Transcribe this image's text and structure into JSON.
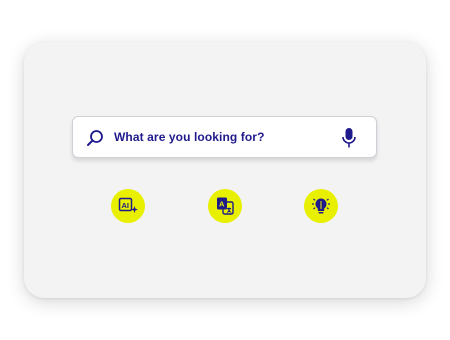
{
  "search": {
    "placeholder": "What are you looking for?",
    "icon": "search-icon",
    "mic_icon": "microphone-icon"
  },
  "features": [
    {
      "icon": "ai-sparkle-icon"
    },
    {
      "icon": "translate-icon"
    },
    {
      "icon": "lightbulb-icon"
    }
  ],
  "colors": {
    "accent": "#1f1a8c",
    "highlight": "#e8f000",
    "card": "#f3f3f4"
  }
}
